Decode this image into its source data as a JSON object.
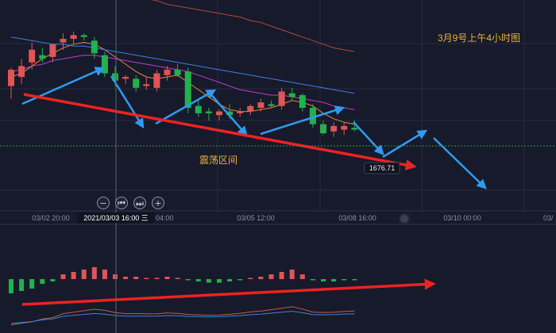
{
  "chart_data": [
    {
      "type": "candlestick",
      "annotation_title": "3月9号上午4小时图",
      "range_label": "震荡区间",
      "price_tag": "1676.71",
      "crosshair_time": "2021/03/03 16:00 三",
      "x_ticks": [
        "03/02 20:00",
        "03/05 12:00",
        "03/08 16:00",
        "03/10 00:00",
        "03/"
      ],
      "hidden_tick_tail": "04:00",
      "ylim": [
        1650,
        1760
      ],
      "grid": true,
      "candles": [
        {
          "o": 1717,
          "h": 1727,
          "l": 1710,
          "c": 1726
        },
        {
          "o": 1722,
          "h": 1732,
          "l": 1718,
          "c": 1728
        },
        {
          "o": 1730,
          "h": 1741,
          "l": 1726,
          "c": 1737
        },
        {
          "o": 1734,
          "h": 1738,
          "l": 1730,
          "c": 1732
        },
        {
          "o": 1733,
          "h": 1740,
          "l": 1730,
          "c": 1740
        },
        {
          "o": 1741,
          "h": 1746,
          "l": 1737,
          "c": 1743
        },
        {
          "o": 1743,
          "h": 1747,
          "l": 1740,
          "c": 1745
        },
        {
          "o": 1745,
          "h": 1746,
          "l": 1742,
          "c": 1744
        },
        {
          "o": 1742,
          "h": 1744,
          "l": 1732,
          "c": 1735
        },
        {
          "o": 1734,
          "h": 1736,
          "l": 1722,
          "c": 1724
        },
        {
          "o": 1724,
          "h": 1728,
          "l": 1717,
          "c": 1720
        },
        {
          "o": 1721,
          "h": 1723,
          "l": 1718,
          "c": 1722
        },
        {
          "o": 1721,
          "h": 1723,
          "l": 1714,
          "c": 1716
        },
        {
          "o": 1717,
          "h": 1722,
          "l": 1715,
          "c": 1718
        },
        {
          "o": 1716,
          "h": 1726,
          "l": 1714,
          "c": 1724
        },
        {
          "o": 1723,
          "h": 1728,
          "l": 1720,
          "c": 1726
        },
        {
          "o": 1726,
          "h": 1729,
          "l": 1722,
          "c": 1723
        },
        {
          "o": 1725,
          "h": 1727,
          "l": 1702,
          "c": 1705
        },
        {
          "o": 1706,
          "h": 1709,
          "l": 1700,
          "c": 1702
        },
        {
          "o": 1703,
          "h": 1705,
          "l": 1698,
          "c": 1702
        },
        {
          "o": 1701,
          "h": 1704,
          "l": 1698,
          "c": 1703
        },
        {
          "o": 1703,
          "h": 1707,
          "l": 1699,
          "c": 1701
        },
        {
          "o": 1702,
          "h": 1705,
          "l": 1700,
          "c": 1703
        },
        {
          "o": 1703,
          "h": 1707,
          "l": 1701,
          "c": 1706
        },
        {
          "o": 1705,
          "h": 1710,
          "l": 1703,
          "c": 1708
        },
        {
          "o": 1707,
          "h": 1709,
          "l": 1705,
          "c": 1706
        },
        {
          "o": 1706,
          "h": 1716,
          "l": 1704,
          "c": 1714
        },
        {
          "o": 1713,
          "h": 1716,
          "l": 1709,
          "c": 1711
        },
        {
          "o": 1712,
          "h": 1713,
          "l": 1703,
          "c": 1705
        },
        {
          "o": 1705,
          "h": 1707,
          "l": 1694,
          "c": 1696
        },
        {
          "o": 1696,
          "h": 1698,
          "l": 1690,
          "c": 1691
        },
        {
          "o": 1692,
          "h": 1697,
          "l": 1689,
          "c": 1695
        },
        {
          "o": 1693,
          "h": 1697,
          "l": 1690,
          "c": 1695
        },
        {
          "o": 1694,
          "h": 1698,
          "l": 1692,
          "c": 1693
        }
      ],
      "ma": [
        {
          "color": "#e08b3c",
          "values": [
            1722,
            1724,
            1728,
            1732,
            1735,
            1738,
            1740,
            1741,
            1740,
            1737,
            1733,
            1729,
            1725,
            1722,
            1721,
            1722,
            1723,
            1719,
            1715,
            1711,
            1707,
            1704,
            1703,
            1703,
            1704,
            1705,
            1707,
            1709,
            1708,
            1706,
            1702,
            1699,
            1697,
            1696
          ]
        },
        {
          "color": "#c23bc9",
          "values": [
            1725,
            1726,
            1728,
            1729,
            1731,
            1732,
            1733,
            1734,
            1734,
            1733,
            1732,
            1731,
            1730,
            1729,
            1728,
            1727,
            1726,
            1725,
            1723,
            1721,
            1719,
            1717,
            1715,
            1714,
            1713,
            1712,
            1712,
            1711,
            1710,
            1709,
            1708,
            1706,
            1705,
            1704
          ]
        },
        {
          "color": "#3f7fe0",
          "values": [
            1744,
            1743,
            1742,
            1741,
            1740,
            1740,
            1739,
            1739,
            1738,
            1737,
            1736,
            1735,
            1734,
            1733,
            1732,
            1731,
            1730,
            1729,
            1728,
            1727,
            1726,
            1725,
            1724,
            1723,
            1722,
            1721,
            1720,
            1719,
            1718,
            1717,
            1716,
            1715,
            1714,
            1713
          ]
        },
        {
          "color": "#b04a3c",
          "values": [
            1788,
            1786,
            1783,
            1780,
            1777,
            1775,
            1773,
            1771,
            1770,
            1769,
            1768,
            1767,
            1766,
            1765,
            1764,
            1762,
            1761,
            1760,
            1759,
            1758,
            1757,
            1756,
            1755,
            1753,
            1752,
            1750,
            1748,
            1746,
            1744,
            1742,
            1740,
            1738,
            1737,
            1736
          ]
        }
      ],
      "macd_hist": [
        -6,
        -5,
        -4,
        -2,
        -1,
        2,
        3,
        4,
        5,
        4,
        2,
        1,
        1,
        0.5,
        0.5,
        1,
        0.5,
        -0.5,
        -1,
        -1.5,
        -1.5,
        -1,
        -0.5,
        0.5,
        1,
        2,
        3,
        4,
        2,
        -0.5,
        -1,
        -1,
        -0.5,
        -0.3
      ],
      "colors": {
        "up": "#e05555",
        "down": "#22b14c",
        "blue_arrow": "#2e9bf0",
        "red_arrow": "#ee2222",
        "annotation": "#e8b33a"
      }
    }
  ]
}
